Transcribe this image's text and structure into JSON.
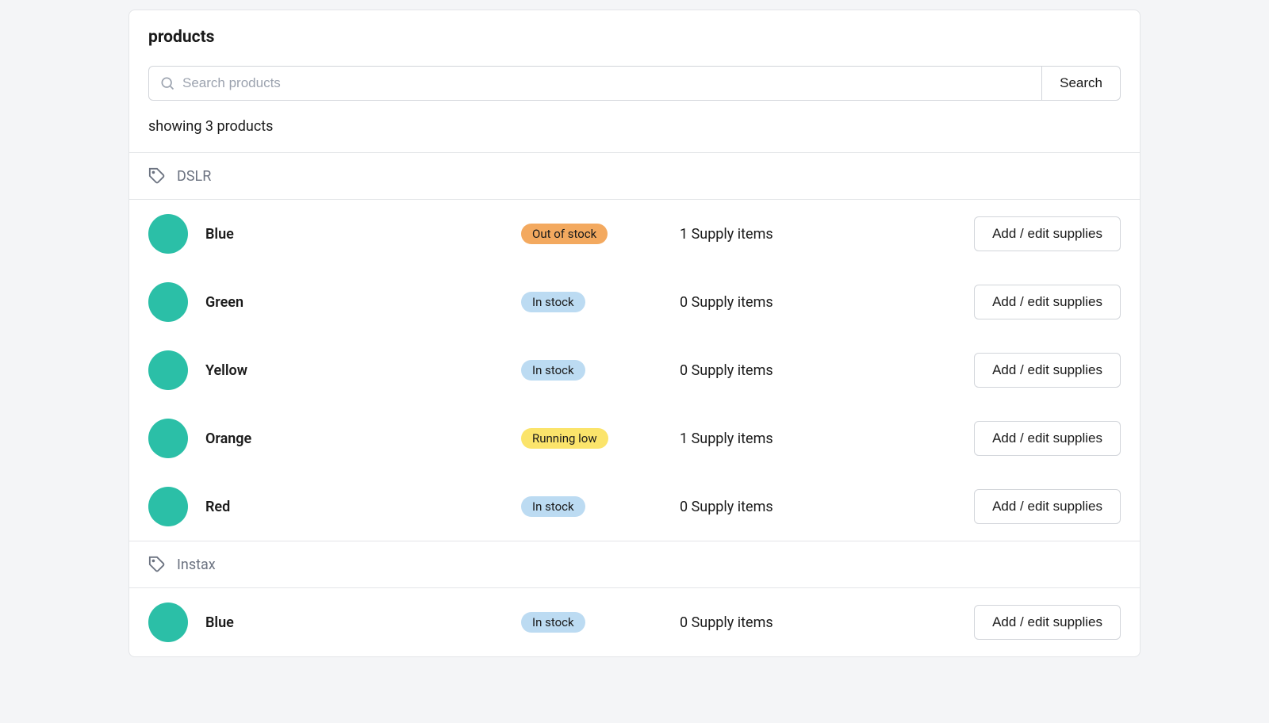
{
  "header": {
    "title": "products"
  },
  "search": {
    "placeholder": "Search products",
    "button": "Search"
  },
  "showing": "showing 3 products",
  "action_label": "Add / edit supplies",
  "status_colors": {
    "out_of_stock": "#f3a95f",
    "in_stock": "#bcdbf2",
    "running_low": "#fbe46b"
  },
  "swatch_color": "#2bbfa7",
  "groups": [
    {
      "label": "DSLR",
      "rows": [
        {
          "name": "Blue",
          "status_text": "Out of stock",
          "status_kind": "out_of_stock",
          "supply": "1 Supply items"
        },
        {
          "name": "Green",
          "status_text": "In stock",
          "status_kind": "in_stock",
          "supply": "0 Supply items"
        },
        {
          "name": "Yellow",
          "status_text": "In stock",
          "status_kind": "in_stock",
          "supply": "0 Supply items"
        },
        {
          "name": "Orange",
          "status_text": "Running low",
          "status_kind": "running_low",
          "supply": "1 Supply items"
        },
        {
          "name": "Red",
          "status_text": "In stock",
          "status_kind": "in_stock",
          "supply": "0 Supply items"
        }
      ]
    },
    {
      "label": "Instax",
      "rows": [
        {
          "name": "Blue",
          "status_text": "In stock",
          "status_kind": "in_stock",
          "supply": "0 Supply items"
        }
      ]
    }
  ]
}
